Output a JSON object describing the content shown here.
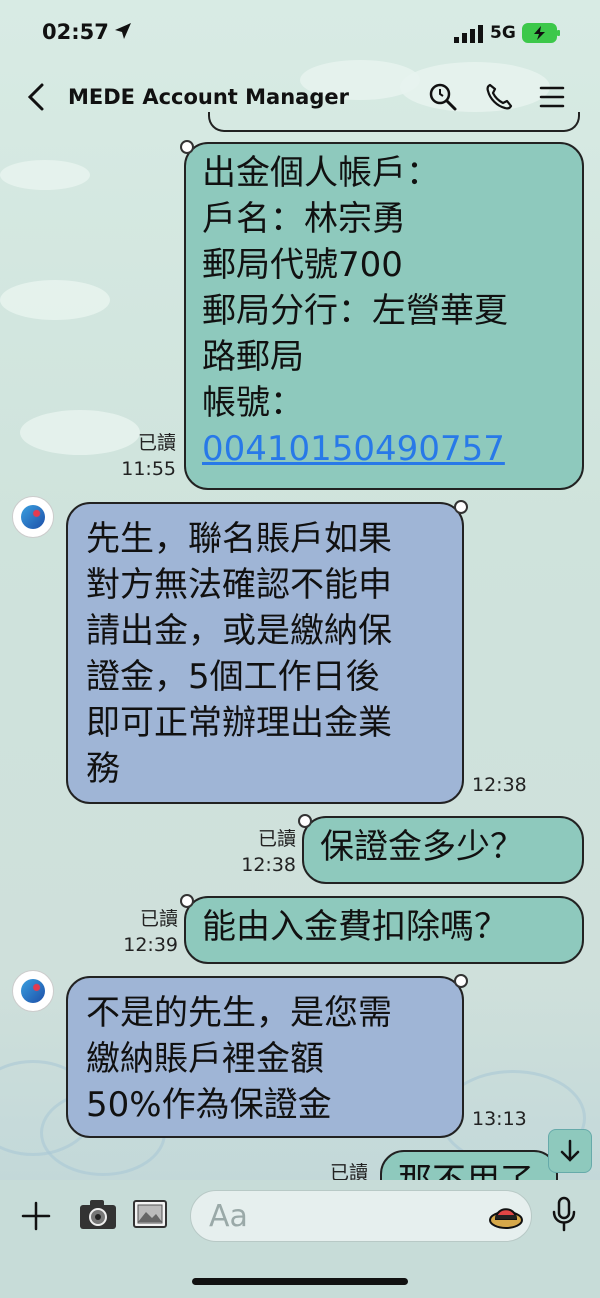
{
  "status": {
    "time": "02:57",
    "network": "5G"
  },
  "header": {
    "title": "MEDE Account Manager"
  },
  "messages": [
    {
      "side": "out",
      "read": "已讀",
      "time": "11:55",
      "lines": [
        "出金個人帳戶：",
        "戶名：林宗勇",
        "郵局代號700",
        "郵局分行：左營華夏",
        "路郵局",
        "帳號："
      ],
      "link": "00410150490757"
    },
    {
      "side": "in",
      "time": "12:38",
      "lines": [
        "先生，聯名賬戶如果",
        "對方無法確認不能申",
        "請出金，或是繳納保",
        "證金，5個工作日後",
        "即可正常辦理出金業",
        "務"
      ]
    },
    {
      "side": "out",
      "read": "已讀",
      "time": "12:38",
      "lines": [
        "保證金多少？"
      ]
    },
    {
      "side": "out",
      "read": "已讀",
      "time": "12:39",
      "lines": [
        "能由入金費扣除嗎？"
      ]
    },
    {
      "side": "in",
      "time": "13:13",
      "lines": [
        "不是的先生，是您需",
        "繳納賬戶裡金額",
        "50%作為保證金"
      ]
    },
    {
      "side": "out",
      "read": "已讀",
      "lines": [
        "那不用了"
      ]
    }
  ],
  "composer": {
    "placeholder": "Aa"
  },
  "icons": {
    "back": "chevron-left-icon",
    "search": "search-icon",
    "call": "phone-icon",
    "menu": "menu-icon",
    "plus": "plus-icon",
    "camera": "camera-icon",
    "gallery": "image-icon",
    "sticker": "sticker-icon",
    "mic": "microphone-icon",
    "scroll": "arrow-down-icon"
  },
  "colors": {
    "outgoing": "#8ec9bd",
    "incoming": "#9fb5d6",
    "link": "#2879e8",
    "battery": "#3cc84a"
  }
}
